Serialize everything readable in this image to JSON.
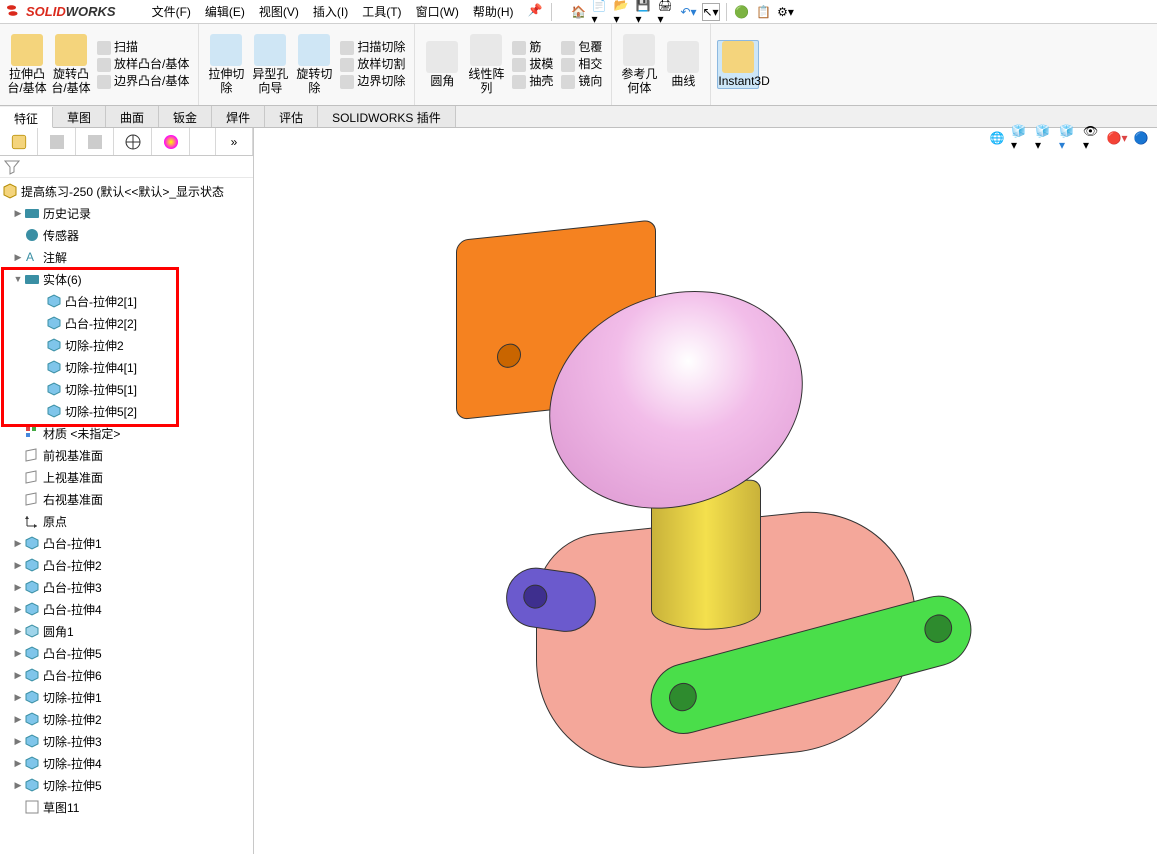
{
  "app_name": {
    "solid": "SOLID",
    "works": "WORKS"
  },
  "menus": [
    {
      "label": "文件(F)"
    },
    {
      "label": "编辑(E)"
    },
    {
      "label": "视图(V)"
    },
    {
      "label": "插入(I)"
    },
    {
      "label": "工具(T)"
    },
    {
      "label": "窗口(W)"
    },
    {
      "label": "帮助(H)"
    }
  ],
  "ribbon": {
    "extrude_boss": "拉伸凸台/基体",
    "revolve_boss": "旋转凸台/基体",
    "swept_boss": "扫描",
    "loft_boss": "放样凸台/基体",
    "boundary_boss": "边界凸台/基体",
    "extrude_cut": "拉伸切除",
    "hole_wizard": "异型孔向导",
    "revolve_cut": "旋转切除",
    "swept_cut": "扫描切除",
    "loft_cut": "放样切割",
    "boundary_cut": "边界切除",
    "fillet": "圆角",
    "linear_pattern": "线性阵列",
    "rib": "筋",
    "draft": "拔模",
    "shell": "抽壳",
    "wrap": "包覆",
    "intersect": "相交",
    "mirror": "镜向",
    "ref_geom": "参考几何体",
    "curves": "曲线",
    "instant3d": "Instant3D"
  },
  "tabs": [
    {
      "label": "特征",
      "active": true
    },
    {
      "label": "草图"
    },
    {
      "label": "曲面"
    },
    {
      "label": "钣金"
    },
    {
      "label": "焊件"
    },
    {
      "label": "评估"
    },
    {
      "label": "SOLIDWORKS 插件"
    }
  ],
  "tree": {
    "root": "提高练习-250  (默认<<默认>_显示状态",
    "history": "历史记录",
    "sensors": "传感器",
    "annotations": "注解",
    "solid_bodies": "实体(6)",
    "bodies": [
      "凸台-拉伸2[1]",
      "凸台-拉伸2[2]",
      "切除-拉伸2",
      "切除-拉伸4[1]",
      "切除-拉伸5[1]",
      "切除-拉伸5[2]"
    ],
    "material": "材质 <未指定>",
    "front_plane": "前视基准面",
    "top_plane": "上视基准面",
    "right_plane": "右视基准面",
    "origin": "原点",
    "features": [
      "凸台-拉伸1",
      "凸台-拉伸2",
      "凸台-拉伸3",
      "凸台-拉伸4",
      "圆角1",
      "凸台-拉伸5",
      "凸台-拉伸6",
      "切除-拉伸1",
      "切除-拉伸2",
      "切除-拉伸3",
      "切除-拉伸4",
      "切除-拉伸5",
      "草图11"
    ]
  },
  "icons": {
    "part_color": "#d4a017",
    "folder_color": "#3a8fa4",
    "body_color": "#4aa0d8",
    "feature_color": "#4aa0d8",
    "plane_color": "#888"
  }
}
